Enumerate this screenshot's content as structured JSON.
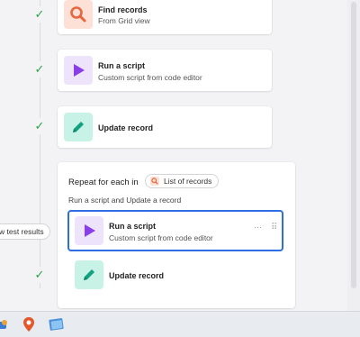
{
  "steps": [
    {
      "title": "Find records",
      "subtitle": "From Grid view",
      "icon": "search-icon"
    },
    {
      "title": "Run a script",
      "subtitle": "Custom script from code editor",
      "icon": "play-icon"
    },
    {
      "title": "Update record",
      "subtitle": "",
      "icon": "pencil-icon"
    }
  ],
  "repeat": {
    "title": "Repeat for each in",
    "pill_label": "List of records",
    "description": "Run a script and Update a record",
    "steps": [
      {
        "title": "Run a script",
        "subtitle": "Custom script from code editor",
        "icon": "play-icon"
      },
      {
        "title": "Update record",
        "icon": "pencil-icon"
      }
    ],
    "more_menu": "···",
    "drag_handle": "⠿"
  },
  "test_results_button": "w test results",
  "colors": {
    "search_bg": "#fde0d6",
    "search_fg": "#e8663d",
    "play_bg": "#ede3fb",
    "play_fg": "#8a3ee8",
    "pencil_bg": "#c9f2e6",
    "pencil_fg": "#11a37f",
    "selected_border": "#2d6fe0",
    "check": "#2aa34a"
  },
  "taskbar": {
    "icons": [
      "app-icon-1",
      "maps-icon",
      "files-icon"
    ]
  }
}
